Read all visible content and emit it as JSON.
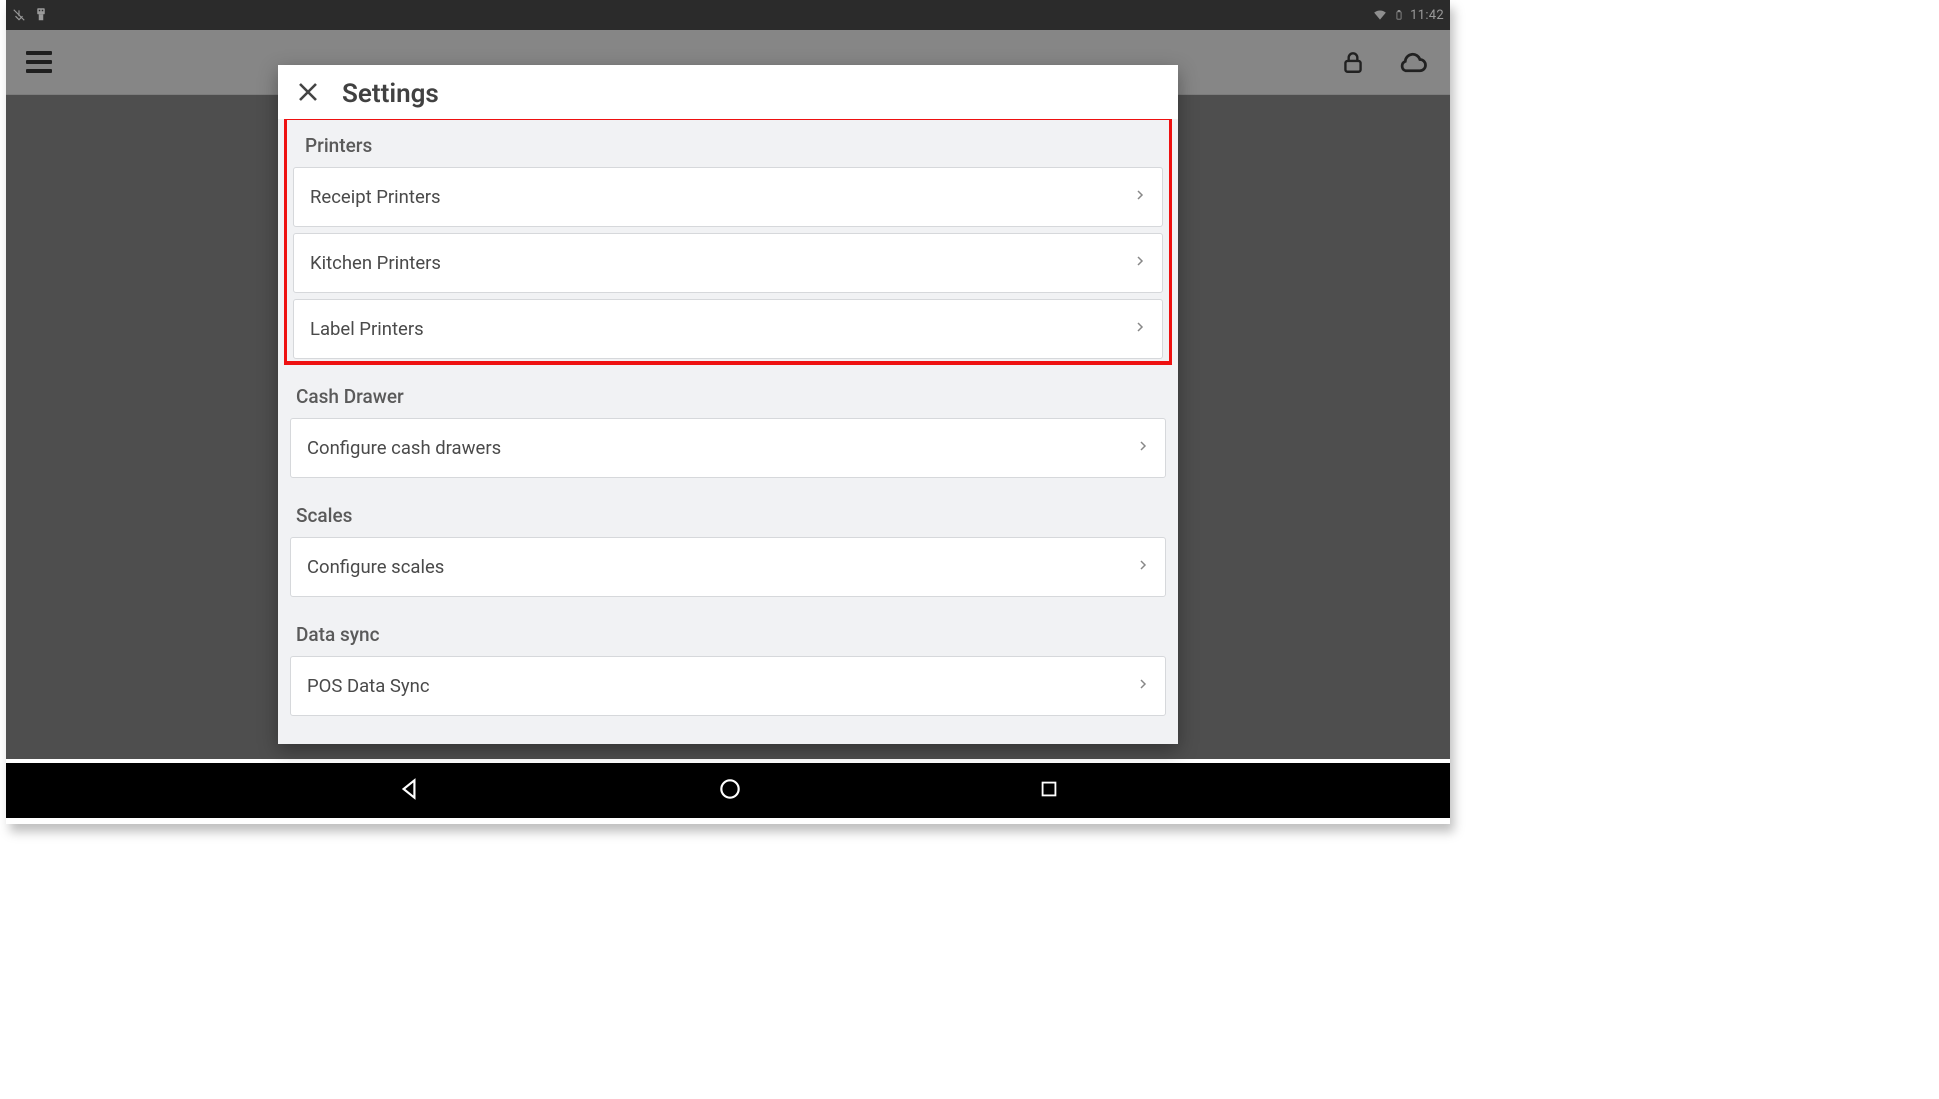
{
  "status": {
    "clock": "11:42"
  },
  "modal": {
    "title": "Settings",
    "sections": [
      {
        "title": "Printers",
        "items": [
          {
            "label": "Receipt Printers"
          },
          {
            "label": "Kitchen Printers"
          },
          {
            "label": "Label Printers"
          }
        ]
      },
      {
        "title": "Cash Drawer",
        "items": [
          {
            "label": "Configure cash drawers"
          }
        ]
      },
      {
        "title": "Scales",
        "items": [
          {
            "label": "Configure scales"
          }
        ]
      },
      {
        "title": "Data sync",
        "items": [
          {
            "label": "POS Data Sync"
          }
        ]
      }
    ]
  }
}
